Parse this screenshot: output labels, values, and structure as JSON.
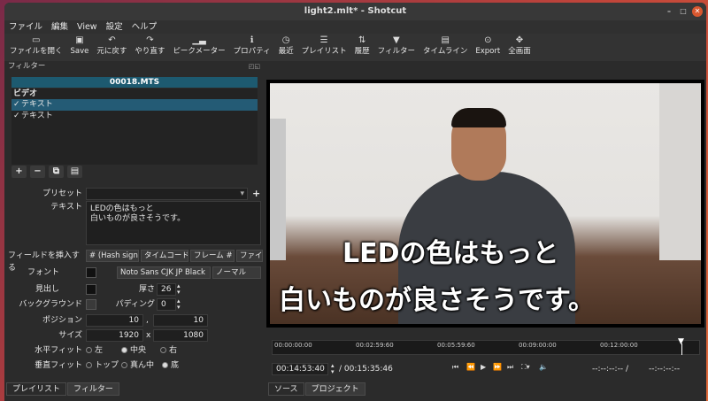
{
  "window": {
    "title": "light2.mlt* - Shotcut"
  },
  "menu": [
    "ファイル",
    "編集",
    "View",
    "設定",
    "ヘルプ"
  ],
  "toolbar": [
    {
      "label": "ファイルを開く",
      "icon": "folder-icon"
    },
    {
      "label": "Save",
      "icon": "save-icon"
    },
    {
      "label": "元に戻す",
      "icon": "undo-icon"
    },
    {
      "label": "やり直す",
      "icon": "redo-icon"
    },
    {
      "label": "ピークメーター",
      "icon": "meter-icon"
    },
    {
      "label": "プロパティ",
      "icon": "info-icon"
    },
    {
      "label": "最近",
      "icon": "clock-icon"
    },
    {
      "label": "プレイリスト",
      "icon": "list-icon"
    },
    {
      "label": "履歴",
      "icon": "history-icon"
    },
    {
      "label": "フィルター",
      "icon": "filter-icon"
    },
    {
      "label": "タイムライン",
      "icon": "timeline-icon"
    },
    {
      "label": "Export",
      "icon": "export-icon"
    },
    {
      "label": "全画面",
      "icon": "fullscreen-icon"
    }
  ],
  "filters_panel": {
    "title": "フィルター",
    "clip_name": "00018.MTS",
    "category": "ビデオ",
    "items": [
      {
        "label": "テキスト",
        "checked": "✓",
        "selected": true
      },
      {
        "label": "テキスト",
        "checked": "✓",
        "selected": false
      }
    ]
  },
  "props": {
    "preset_label": "プリセット",
    "preset_value": "",
    "text_label": "テキスト",
    "text_line1": "LEDの色はもっと",
    "text_line2": "白いものが良さそうです。",
    "insert_label": "フィールドを挿入する",
    "insert_buttons": [
      "# (Hash sign)",
      "タイムコード",
      "フレーム #",
      "ファイル"
    ],
    "font_label": "フォント",
    "font_name": "Noto Sans CJK JP Black",
    "font_style": "ノーマル",
    "outline_label": "見出し",
    "thickness_label": "厚さ",
    "thickness_value": "26",
    "background_label": "バックグラウンド",
    "padding_label": "パディング",
    "padding_value": "0",
    "position_label": "ポジション",
    "position_x": "10",
    "position_sep": ",",
    "position_y": "10",
    "size_label": "サイズ",
    "size_w": "1920",
    "size_sep": "x",
    "size_h": "1080",
    "hfit_label": "水平フィット",
    "hfit_options": [
      "左",
      "中央",
      "右"
    ],
    "hfit_selected": "中央",
    "vfit_label": "垂直フィット",
    "vfit_options": [
      "トップ",
      "真ん中",
      "底"
    ],
    "vfit_selected": "底"
  },
  "bottom_tabs_left": [
    "プレイリスト",
    "フィルター"
  ],
  "bottom_tabs_right": [
    "ソース",
    "プロジェクト"
  ],
  "viewer": {
    "subtitle_line1": "LEDの色はもっと",
    "subtitle_line2": "白いものが良さそうです。"
  },
  "timeline": {
    "ticks": [
      "00:00:00:00",
      "00:02:59:60",
      "00:05:59:60",
      "00:09:00:00",
      "00:12:00:00"
    ],
    "current": "00:14:53:40",
    "total": "/ 00:15:35:46",
    "in_point": "--:--:--:-- /",
    "out_point": "--:--:--:--"
  },
  "colors": {
    "accent": "#245b75",
    "panel": "#2b2b2b"
  }
}
